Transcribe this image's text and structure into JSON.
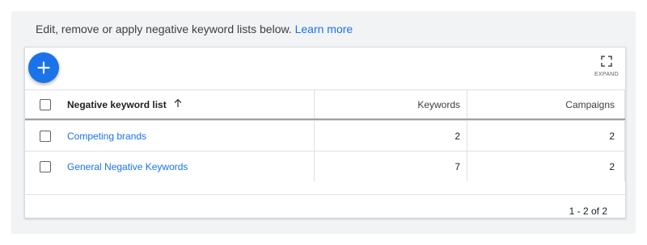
{
  "intro": {
    "text": "Edit, remove or apply negative keyword lists below.",
    "link": "Learn more"
  },
  "toolbar": {
    "add_icon": "plus-icon",
    "expand_label": "EXPAND",
    "expand_icon": "fullscreen-icon"
  },
  "table": {
    "columns": [
      "Negative keyword list",
      "Keywords",
      "Campaigns"
    ],
    "sort_icon": "arrow-up-icon",
    "rows": [
      {
        "name": "Competing brands",
        "keywords": "2",
        "campaigns": "2"
      },
      {
        "name": "General Negative Keywords",
        "keywords": "7",
        "campaigns": "2"
      }
    ]
  },
  "pagination": {
    "text": "1 - 2 of 2"
  },
  "colors": {
    "accent": "#1a73e8",
    "background": "#f1f3f4"
  }
}
